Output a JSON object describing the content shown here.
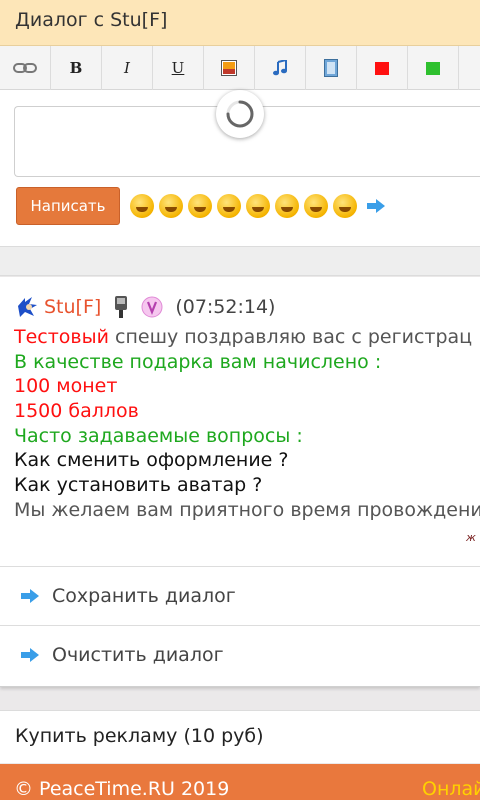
{
  "header": {
    "title": "Диалог с Stu[F]"
  },
  "toolbar": {
    "buttons": [
      {
        "name": "link-button",
        "glyph": ""
      },
      {
        "name": "bold-button",
        "glyph": "B"
      },
      {
        "name": "italic-button",
        "glyph": "I"
      },
      {
        "name": "underline-button",
        "glyph": "U"
      },
      {
        "name": "image-button",
        "glyph": ""
      },
      {
        "name": "music-button",
        "glyph": ""
      },
      {
        "name": "video-button",
        "glyph": ""
      },
      {
        "name": "red-color-button",
        "glyph": ""
      },
      {
        "name": "green-color-button",
        "glyph": ""
      }
    ],
    "colors": {
      "red": "#ff1010",
      "green": "#2ec02e"
    }
  },
  "compose": {
    "input_value": "",
    "send_label": "Написать",
    "smiley_count": 8
  },
  "message": {
    "nick": "Stu[F]",
    "time": "(07:52:14)",
    "lines": [
      {
        "highlight": "Тестовый",
        "text": " спешу поздравляю вас с регистрац"
      },
      {
        "text": "В качестве подарка вам начислено :"
      },
      {
        "text": "100 монет"
      },
      {
        "text": "1500 баллов"
      },
      {
        "text": "Часто задаваемые вопросы :"
      },
      {
        "text": "Как сменить оформление ?"
      },
      {
        "text": "Как установить аватар ?"
      },
      {
        "text": "Мы желаем вам приятного время провождени"
      }
    ],
    "signature": "ж"
  },
  "actions": {
    "save_label": "Сохранить диалог",
    "clear_label": "Очистить диалог"
  },
  "ad": {
    "label": "Купить рекламу (10 руб)"
  },
  "footer": {
    "copyright": "© PeaceTime.RU 2019",
    "online": "Онлай"
  },
  "colors": {
    "accent": "#e9783d",
    "title_bg": "#fde6b8",
    "nick": "#e8532e"
  }
}
